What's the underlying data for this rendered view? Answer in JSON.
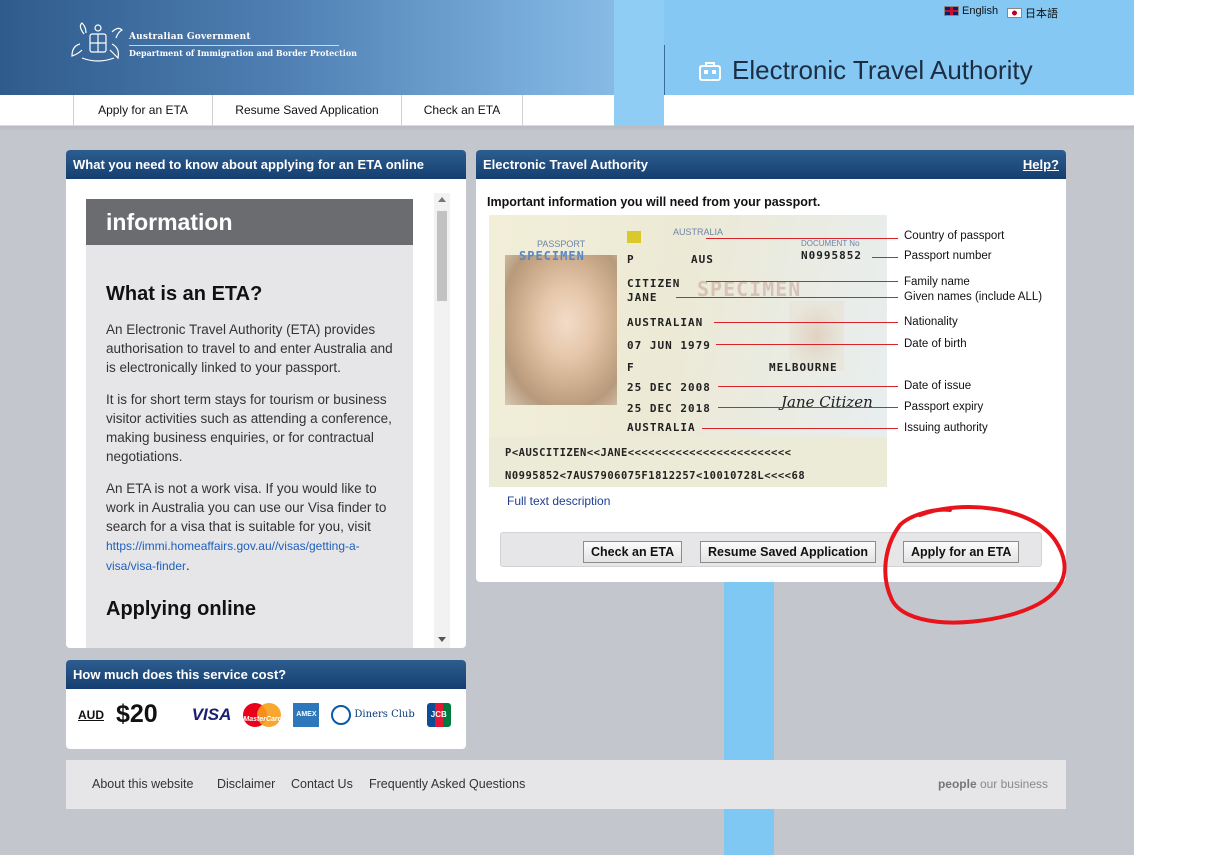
{
  "header": {
    "gov_line1": "Australian Government",
    "gov_line2": "Department of Immigration and Border Protection",
    "languages": [
      {
        "label": "English",
        "flag": "uk-flag-icon"
      },
      {
        "label": "日本語",
        "flag": "japan-flag-icon"
      }
    ],
    "app_title": "Electronic Travel Authority"
  },
  "nav": {
    "items": [
      "Apply for an ETA",
      "Resume Saved Application",
      "Check an ETA"
    ]
  },
  "info_panel": {
    "title": "What you need to know about applying for an ETA online",
    "band": "information",
    "heading1": "What is an ETA?",
    "p1": "An Electronic Travel Authority (ETA) provides authorisation to travel to and enter Australia and is electronically linked to your passport.",
    "p2": "It is for short term stays for tourism or business visitor activities such as attending a conference, making business enquiries, or for contractual negotiations.",
    "p3": "An ETA is not a work visa. If you would like to work in Australia you can use our Visa finder to search for a visa that is suitable for you, visit",
    "p3_link": "https://immi.homeaffairs.gov.au//visas/getting-a-visa/visa-finder",
    "p3_end": ".",
    "heading2": "Applying online"
  },
  "cost_panel": {
    "title": "How much does this service cost?",
    "currency": "AUD",
    "price": "$20",
    "cards": [
      "VISA",
      "MasterCard",
      "AMEX",
      "Diners Club",
      "JCB"
    ]
  },
  "eta_panel": {
    "title": "Electronic Travel Authority",
    "help": "Help?",
    "caption": "Important information you will need from your passport.",
    "passport": {
      "country_heading": "AUSTRALIA",
      "header_left": "PASSPORT",
      "specimen": "SPECIMEN",
      "specimen_watermark": "SPECIMEN",
      "document_no_label": "DOCUMENT No",
      "type": "P",
      "country_code": "AUS",
      "document_no": "N0995852",
      "surname": "CITIZEN",
      "given_names": "JANE",
      "nationality": "AUSTRALIAN",
      "dob": "07 JUN 1979",
      "sex": "F",
      "place_of_birth": "MELBOURNE",
      "issue_date": "25 DEC 2008",
      "expiry_date": "25 DEC 2018",
      "authority": "AUSTRALIA",
      "signature": "Jane Citizen",
      "mrz1": "P<AUSCITIZEN<<JANE<<<<<<<<<<<<<<<<<<<<<<<<",
      "mrz2": "N0995852<7AUS7906075F1812257<10010728L<<<<68"
    },
    "callouts": [
      "Country of passport",
      "Passport number",
      "Family name",
      "Given names (include ALL)",
      "Nationality",
      "Date of birth",
      "Date of issue",
      "Passport expiry",
      "Issuing authority"
    ],
    "full_text_link": "Full text description",
    "buttons": [
      "Check an ETA",
      "Resume Saved Application",
      "Apply for an ETA"
    ]
  },
  "footer": {
    "links": [
      "About this website",
      "Disclaimer",
      "Contact Us",
      "Frequently Asked Questions"
    ],
    "tagline_bold": "people",
    "tagline_rest": " our business"
  },
  "colors": {
    "panel_header": "#1d4a7e",
    "accent_blue": "#7fc8f3",
    "annotation_red": "#e8141c"
  }
}
